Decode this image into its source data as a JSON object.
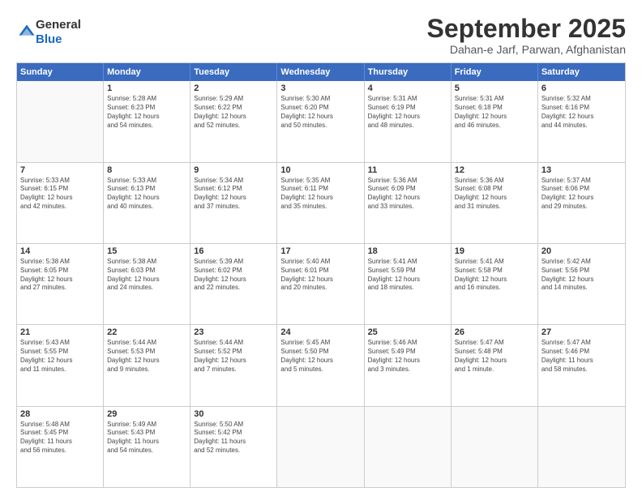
{
  "logo": {
    "line1": "General",
    "line2": "Blue"
  },
  "header": {
    "month": "September 2025",
    "location": "Dahan-e Jarf, Parwan, Afghanistan"
  },
  "weekdays": [
    "Sunday",
    "Monday",
    "Tuesday",
    "Wednesday",
    "Thursday",
    "Friday",
    "Saturday"
  ],
  "rows": [
    [
      {
        "day": "",
        "lines": []
      },
      {
        "day": "1",
        "lines": [
          "Sunrise: 5:28 AM",
          "Sunset: 6:23 PM",
          "Daylight: 12 hours",
          "and 54 minutes."
        ]
      },
      {
        "day": "2",
        "lines": [
          "Sunrise: 5:29 AM",
          "Sunset: 6:22 PM",
          "Daylight: 12 hours",
          "and 52 minutes."
        ]
      },
      {
        "day": "3",
        "lines": [
          "Sunrise: 5:30 AM",
          "Sunset: 6:20 PM",
          "Daylight: 12 hours",
          "and 50 minutes."
        ]
      },
      {
        "day": "4",
        "lines": [
          "Sunrise: 5:31 AM",
          "Sunset: 6:19 PM",
          "Daylight: 12 hours",
          "and 48 minutes."
        ]
      },
      {
        "day": "5",
        "lines": [
          "Sunrise: 5:31 AM",
          "Sunset: 6:18 PM",
          "Daylight: 12 hours",
          "and 46 minutes."
        ]
      },
      {
        "day": "6",
        "lines": [
          "Sunrise: 5:32 AM",
          "Sunset: 6:16 PM",
          "Daylight: 12 hours",
          "and 44 minutes."
        ]
      }
    ],
    [
      {
        "day": "7",
        "lines": [
          "Sunrise: 5:33 AM",
          "Sunset: 6:15 PM",
          "Daylight: 12 hours",
          "and 42 minutes."
        ]
      },
      {
        "day": "8",
        "lines": [
          "Sunrise: 5:33 AM",
          "Sunset: 6:13 PM",
          "Daylight: 12 hours",
          "and 40 minutes."
        ]
      },
      {
        "day": "9",
        "lines": [
          "Sunrise: 5:34 AM",
          "Sunset: 6:12 PM",
          "Daylight: 12 hours",
          "and 37 minutes."
        ]
      },
      {
        "day": "10",
        "lines": [
          "Sunrise: 5:35 AM",
          "Sunset: 6:11 PM",
          "Daylight: 12 hours",
          "and 35 minutes."
        ]
      },
      {
        "day": "11",
        "lines": [
          "Sunrise: 5:36 AM",
          "Sunset: 6:09 PM",
          "Daylight: 12 hours",
          "and 33 minutes."
        ]
      },
      {
        "day": "12",
        "lines": [
          "Sunrise: 5:36 AM",
          "Sunset: 6:08 PM",
          "Daylight: 12 hours",
          "and 31 minutes."
        ]
      },
      {
        "day": "13",
        "lines": [
          "Sunrise: 5:37 AM",
          "Sunset: 6:06 PM",
          "Daylight: 12 hours",
          "and 29 minutes."
        ]
      }
    ],
    [
      {
        "day": "14",
        "lines": [
          "Sunrise: 5:38 AM",
          "Sunset: 6:05 PM",
          "Daylight: 12 hours",
          "and 27 minutes."
        ]
      },
      {
        "day": "15",
        "lines": [
          "Sunrise: 5:38 AM",
          "Sunset: 6:03 PM",
          "Daylight: 12 hours",
          "and 24 minutes."
        ]
      },
      {
        "day": "16",
        "lines": [
          "Sunrise: 5:39 AM",
          "Sunset: 6:02 PM",
          "Daylight: 12 hours",
          "and 22 minutes."
        ]
      },
      {
        "day": "17",
        "lines": [
          "Sunrise: 5:40 AM",
          "Sunset: 6:01 PM",
          "Daylight: 12 hours",
          "and 20 minutes."
        ]
      },
      {
        "day": "18",
        "lines": [
          "Sunrise: 5:41 AM",
          "Sunset: 5:59 PM",
          "Daylight: 12 hours",
          "and 18 minutes."
        ]
      },
      {
        "day": "19",
        "lines": [
          "Sunrise: 5:41 AM",
          "Sunset: 5:58 PM",
          "Daylight: 12 hours",
          "and 16 minutes."
        ]
      },
      {
        "day": "20",
        "lines": [
          "Sunrise: 5:42 AM",
          "Sunset: 5:56 PM",
          "Daylight: 12 hours",
          "and 14 minutes."
        ]
      }
    ],
    [
      {
        "day": "21",
        "lines": [
          "Sunrise: 5:43 AM",
          "Sunset: 5:55 PM",
          "Daylight: 12 hours",
          "and 11 minutes."
        ]
      },
      {
        "day": "22",
        "lines": [
          "Sunrise: 5:44 AM",
          "Sunset: 5:53 PM",
          "Daylight: 12 hours",
          "and 9 minutes."
        ]
      },
      {
        "day": "23",
        "lines": [
          "Sunrise: 5:44 AM",
          "Sunset: 5:52 PM",
          "Daylight: 12 hours",
          "and 7 minutes."
        ]
      },
      {
        "day": "24",
        "lines": [
          "Sunrise: 5:45 AM",
          "Sunset: 5:50 PM",
          "Daylight: 12 hours",
          "and 5 minutes."
        ]
      },
      {
        "day": "25",
        "lines": [
          "Sunrise: 5:46 AM",
          "Sunset: 5:49 PM",
          "Daylight: 12 hours",
          "and 3 minutes."
        ]
      },
      {
        "day": "26",
        "lines": [
          "Sunrise: 5:47 AM",
          "Sunset: 5:48 PM",
          "Daylight: 12 hours",
          "and 1 minute."
        ]
      },
      {
        "day": "27",
        "lines": [
          "Sunrise: 5:47 AM",
          "Sunset: 5:46 PM",
          "Daylight: 11 hours",
          "and 58 minutes."
        ]
      }
    ],
    [
      {
        "day": "28",
        "lines": [
          "Sunrise: 5:48 AM",
          "Sunset: 5:45 PM",
          "Daylight: 11 hours",
          "and 56 minutes."
        ]
      },
      {
        "day": "29",
        "lines": [
          "Sunrise: 5:49 AM",
          "Sunset: 5:43 PM",
          "Daylight: 11 hours",
          "and 54 minutes."
        ]
      },
      {
        "day": "30",
        "lines": [
          "Sunrise: 5:50 AM",
          "Sunset: 5:42 PM",
          "Daylight: 11 hours",
          "and 52 minutes."
        ]
      },
      {
        "day": "",
        "lines": []
      },
      {
        "day": "",
        "lines": []
      },
      {
        "day": "",
        "lines": []
      },
      {
        "day": "",
        "lines": []
      }
    ]
  ]
}
